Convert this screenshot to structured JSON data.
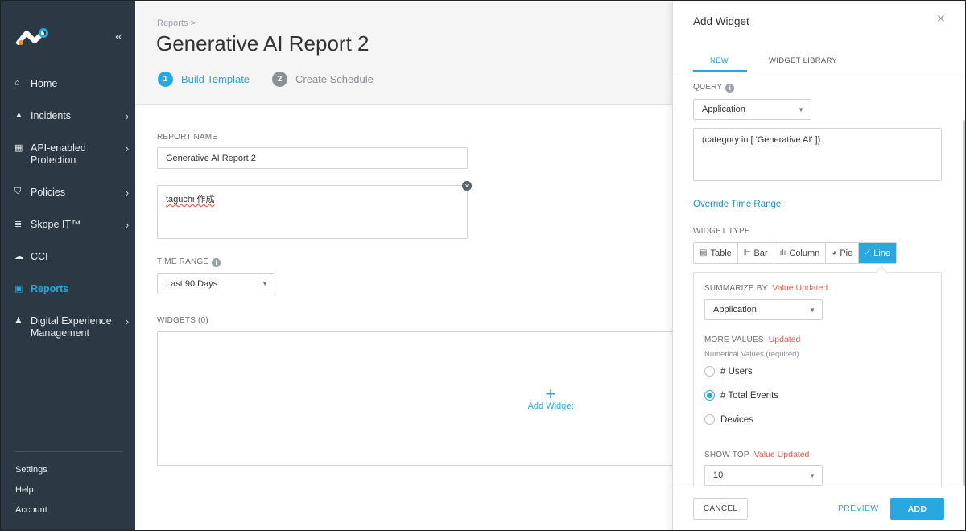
{
  "sidebar": {
    "collapse_icon": "double-chevron-left-icon",
    "items": [
      {
        "label": "Home",
        "icon": "home-icon"
      },
      {
        "label": "Incidents",
        "icon": "warning-icon",
        "chevron": "›"
      },
      {
        "label": "API-enabled Protection",
        "icon": "api-icon",
        "chevron": "›"
      },
      {
        "label": "Policies",
        "icon": "shield-icon",
        "chevron": "›"
      },
      {
        "label": "Skope IT™",
        "icon": "database-icon",
        "chevron": "›"
      },
      {
        "label": "CCI",
        "icon": "cloud-icon"
      },
      {
        "label": "Reports",
        "icon": "report-icon"
      },
      {
        "label": "Digital Experience Management",
        "icon": "user-chart-icon",
        "chevron": "›"
      }
    ],
    "bottom_links": [
      "Settings",
      "Help",
      "Account"
    ]
  },
  "header": {
    "breadcrumb": "Reports >",
    "title": "Generative AI Report 2",
    "steps": [
      {
        "num": "1",
        "label": "Build Template"
      },
      {
        "num": "2",
        "label": "Create Schedule"
      }
    ]
  },
  "form": {
    "report_name_label": "REPORT NAME",
    "report_name_value": "Generative AI Report 2",
    "description_value": "taguchi 作成",
    "time_range_label": "TIME RANGE",
    "time_range_value": "Last 90 Days",
    "widgets_label": "WIDGETS (0)",
    "add_widget_label": "Add Widget"
  },
  "panel": {
    "title": "Add Widget",
    "tabs": [
      "NEW",
      "WIDGET LIBRARY"
    ],
    "query_label": "QUERY",
    "query_select": "Application",
    "query_text": "(category in [ 'Generative AI' ])",
    "override_link": "Override Time Range",
    "widget_type_label": "WIDGET TYPE",
    "widget_types": [
      {
        "label": "Table",
        "glyph": "▤"
      },
      {
        "label": "Bar",
        "glyph": "⊫"
      },
      {
        "label": "Column",
        "glyph": "ılı"
      },
      {
        "label": "Pie",
        "glyph": "◕"
      },
      {
        "label": "Line",
        "glyph": "⟋"
      }
    ],
    "selected_widget_type": "Line",
    "summarize_label": "SUMMARIZE BY",
    "summarize_flag": "Value Updated",
    "summarize_value": "Application",
    "more_values_label": "MORE VALUES",
    "more_values_flag": "Updated",
    "numerical_note": "Numerical Values (required)",
    "radio_options": [
      "# Users",
      "# Total Events",
      "Devices"
    ],
    "radio_selected": "# Total Events",
    "show_top_label": "SHOW TOP",
    "show_top_flag": "Value Updated",
    "show_top_value": "10",
    "buttons": {
      "cancel": "CANCEL",
      "preview": "PREVIEW",
      "add": "ADD"
    }
  },
  "colors": {
    "sidebar_bg": "#2c3944",
    "accent": "#29a8df",
    "updated": "#e85a4f"
  }
}
